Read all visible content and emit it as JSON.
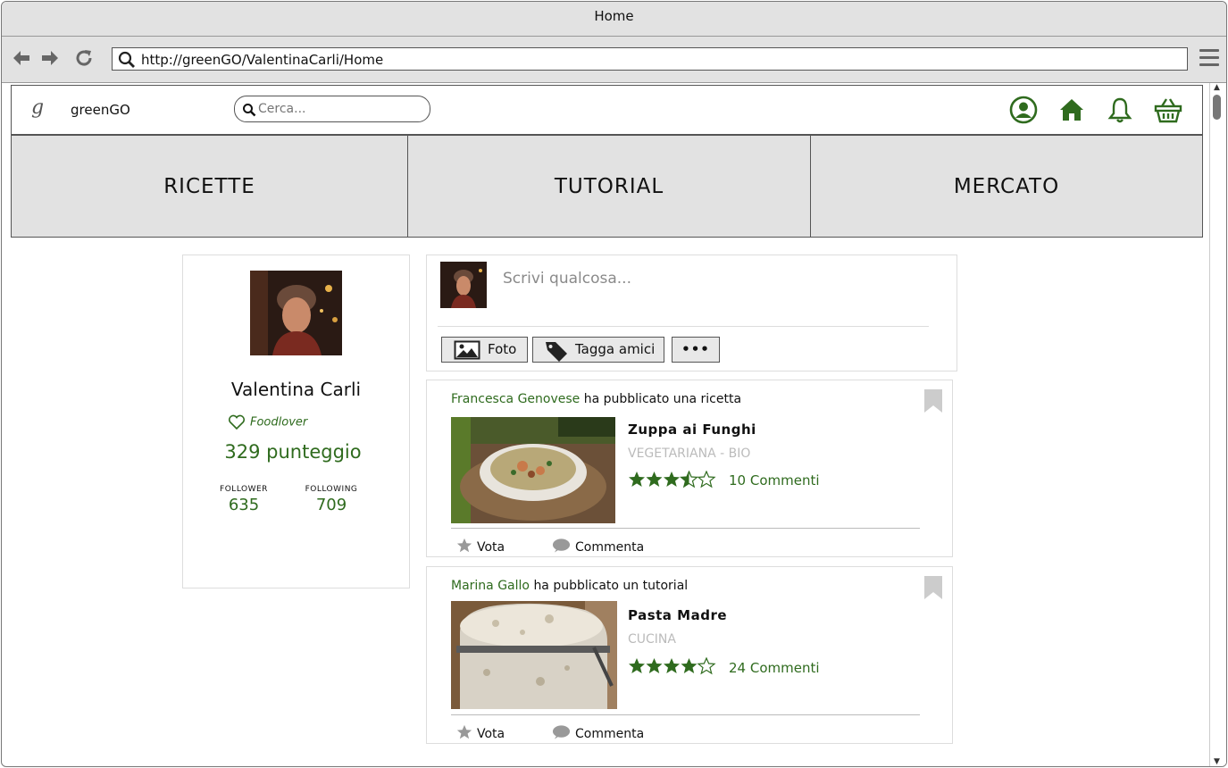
{
  "window": {
    "title": "Home"
  },
  "browser": {
    "url": "http://greenGO/ValentinaCarli/Home"
  },
  "app": {
    "logo_glyph": "g",
    "name": "greenGO",
    "search_placeholder": "Cerca...",
    "header_icons": [
      "user-circle-icon",
      "home-icon",
      "bell-icon",
      "basket-icon"
    ],
    "accent_color": "#2f6b1e"
  },
  "tabs": [
    {
      "label": "RICETTE"
    },
    {
      "label": "TUTORIAL"
    },
    {
      "label": "MERCATO"
    }
  ],
  "profile": {
    "name": "Valentina Carli",
    "badge": "Foodlover",
    "score": "329 punteggio",
    "follower_label": "FOLLOWER",
    "follower_count": "635",
    "following_label": "FOLLOWING",
    "following_count": "709"
  },
  "composer": {
    "placeholder": "Scrivi qualcosa...",
    "photo_label": "Foto",
    "tag_label": "Tagga amici",
    "more_label": "•••"
  },
  "posts": [
    {
      "author": "Francesca Genovese",
      "action": "ha pubblicato una ricetta",
      "title": "Zuppa ai Funghi",
      "category": "VEGETARIANA - BIO",
      "rating": 3.5,
      "comments": "10 Commenti",
      "vote_label": "Vota",
      "comment_label": "Commenta"
    },
    {
      "author": "Marina Gallo",
      "action": "ha pubblicato un tutorial",
      "title": "Pasta Madre",
      "category": "CUCINA",
      "rating": 4,
      "comments": "24 Commenti",
      "vote_label": "Vota",
      "comment_label": "Commenta"
    }
  ]
}
